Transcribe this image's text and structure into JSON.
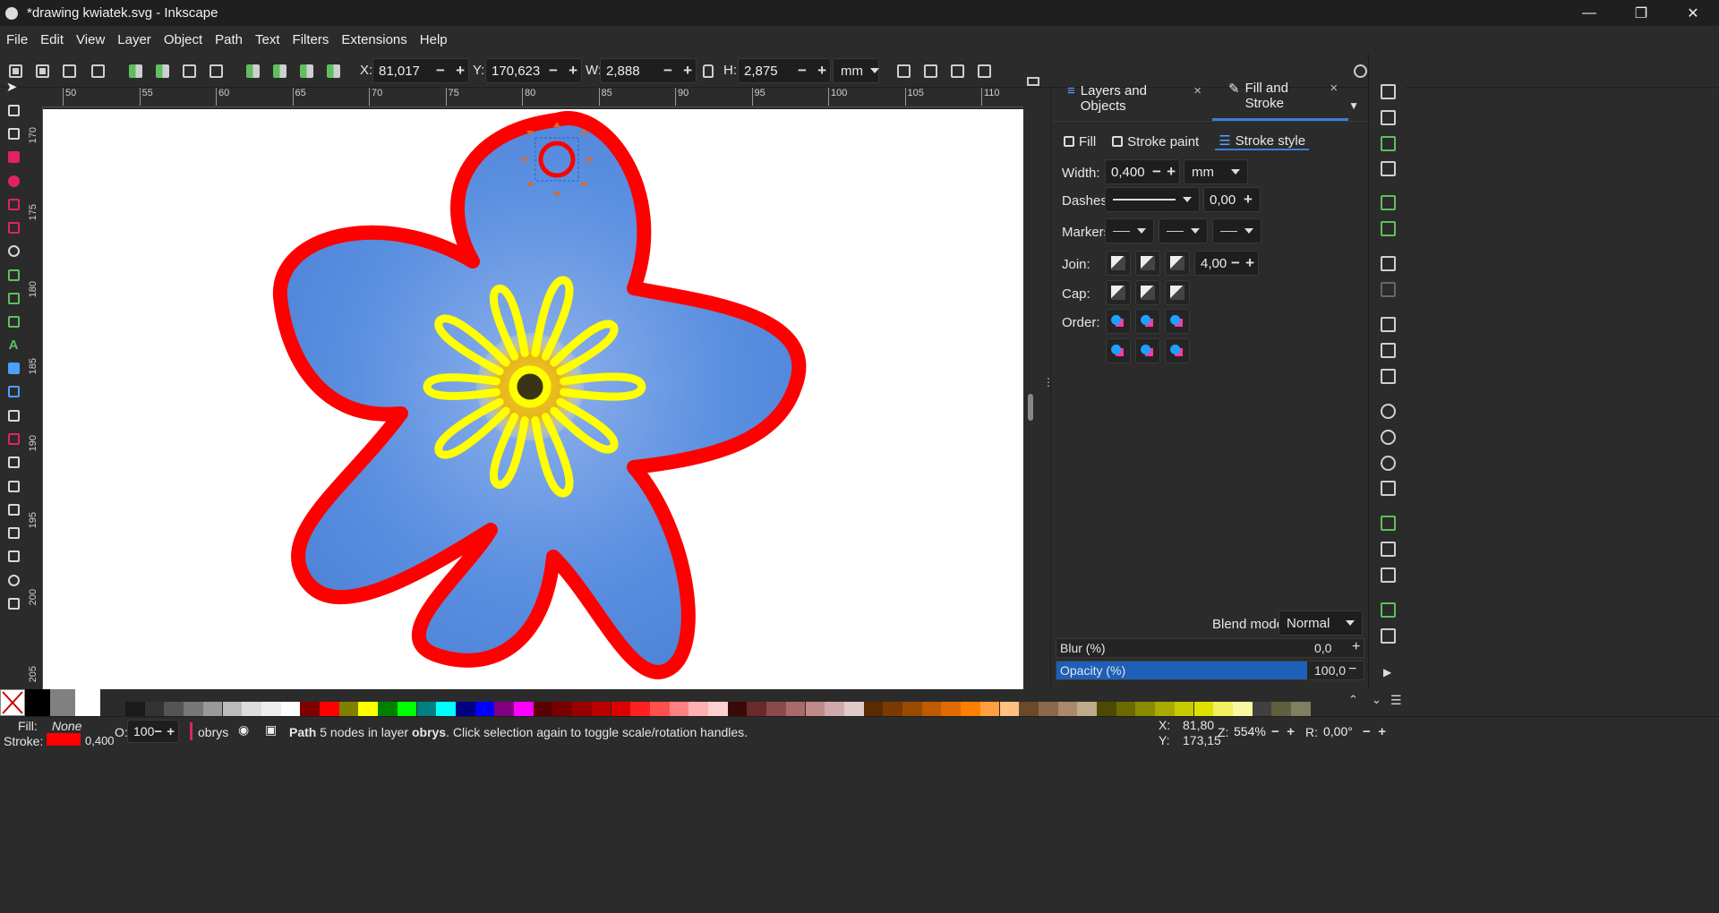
{
  "window": {
    "title": "*drawing kwiatek.svg - Inkscape",
    "controls": [
      "—",
      "❐",
      "✕"
    ]
  },
  "menu": [
    "File",
    "Edit",
    "View",
    "Layer",
    "Object",
    "Path",
    "Text",
    "Filters",
    "Extensions",
    "Help"
  ],
  "toolbar": {
    "x_label": "X:",
    "x_value": "81,017",
    "y_label": "Y:",
    "y_value": "170,623",
    "w_label": "W:",
    "w_value": "2,888",
    "h_label": "H:",
    "h_value": "2,875",
    "unit": "mm"
  },
  "ruler": {
    "h_ticks": [
      "50",
      "55",
      "60",
      "65",
      "70",
      "75",
      "80",
      "85",
      "90",
      "95",
      "100",
      "105",
      "110"
    ],
    "v_ticks": [
      "170",
      "175",
      "180",
      "185",
      "190",
      "195",
      "200",
      "205"
    ]
  },
  "panel": {
    "tabs": [
      {
        "label": "Layers and Objects",
        "close": "×"
      },
      {
        "label": "Fill and Stroke",
        "close": "×"
      }
    ],
    "subtabs": [
      "Fill",
      "Stroke paint",
      "Stroke style"
    ],
    "width_label": "Width:",
    "width_value": "0,400",
    "width_unit": "mm",
    "dashes_label": "Dashes:",
    "dashes_value": "0,00",
    "markers_label": "Markers:",
    "join_label": "Join:",
    "join_value": "4,00",
    "cap_label": "Cap:",
    "order_label": "Order:",
    "blend_label": "Blend mode:",
    "blend_value": "Normal",
    "blur_label": "Blur (%)",
    "blur_value": "0,0",
    "opacity_label": "Opacity (%)",
    "opacity_value": "100,0",
    "opacity_level": 1.0
  },
  "status": {
    "fill_label": "Fill:",
    "fill_value": "None",
    "stroke_label": "Stroke:",
    "stroke_width": "0,400",
    "stroke_color": "#ff0000",
    "o_label": "O:",
    "o_value": "100",
    "layer": "obrys",
    "msg_bold_1": "Path",
    "msg_1": " 5 nodes in layer ",
    "msg_bold_2": "obrys",
    "msg_2": ". Click selection again to toggle scale/rotation handles.",
    "x_label": "X:",
    "x_value": "81,80",
    "y_label": "Y:",
    "y_value": "173,15",
    "z_label": "Z:",
    "z_value": "554%",
    "r_label": "R:",
    "r_value": "0,00°"
  },
  "colors": {
    "outline": "#ff0000",
    "petal": "#5b8fe0",
    "center_ring": "#ffff00",
    "accent": "#3c7fd8"
  }
}
